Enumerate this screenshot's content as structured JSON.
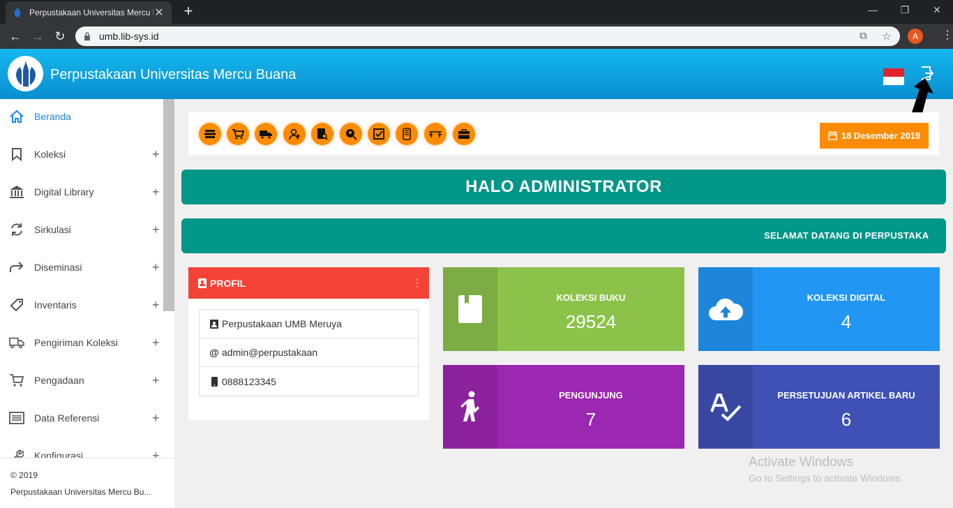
{
  "browser": {
    "tab_title": "Perpustakaan Universitas Mercu Buana",
    "url": "umb.lib-sys.id",
    "profile_initial": "A"
  },
  "header": {
    "title": "Perpustakaan Universitas Mercu Buana"
  },
  "sidebar": {
    "items": [
      {
        "label": "Beranda",
        "icon": "home-icon"
      },
      {
        "label": "Koleksi",
        "icon": "bookmark-icon"
      },
      {
        "label": "Digital Library",
        "icon": "bank-icon"
      },
      {
        "label": "Sirkulasi",
        "icon": "refresh-icon"
      },
      {
        "label": "Diseminasi",
        "icon": "share-arrow-icon"
      },
      {
        "label": "Inventaris",
        "icon": "tag-icon"
      },
      {
        "label": "Pengiriman Koleksi",
        "icon": "truck-icon"
      },
      {
        "label": "Pengadaan",
        "icon": "cart-icon"
      },
      {
        "label": "Data Referensi",
        "icon": "list-icon"
      },
      {
        "label": "Konfigurasi",
        "icon": "wrench-icon"
      }
    ],
    "plus": "+",
    "footer_copyright": "© 2019",
    "footer_org": "Perpustakaan Universitas Mercu Bu..."
  },
  "quickbar": {
    "date": "18 Desember 2019"
  },
  "banner": {
    "greeting": "HALO ADMINISTRATOR",
    "marquee": "SELAMAT DATANG DI PERPUSTAKA"
  },
  "profile": {
    "title": "PROFIL",
    "name": "Perpustakaan UMB Meruya",
    "email": "admin@perpustakaan",
    "phone": "0888123345"
  },
  "stats": [
    {
      "label": "KOLEKSI BUKU",
      "value": "29524",
      "color": "#8bc34a",
      "icon_color": "#7cac43"
    },
    {
      "label": "KOLEKSI DIGITAL",
      "value": "4",
      "color": "#2196f3",
      "icon_color": "#1e86da"
    },
    {
      "label": "PENGUNJUNG",
      "value": "7",
      "color": "#9c27b0",
      "icon_color": "#8c229e"
    },
    {
      "label": "PERSETUJUAN ARTIKEL BARU",
      "value": "6",
      "color": "#3f51b5",
      "icon_color": "#3848a2"
    }
  ],
  "watermark": {
    "line1": "Activate Windows",
    "line2": "Go to Settings to activate Windows."
  },
  "colors": {
    "header_gradient_top": "#14b8ee",
    "teal": "#009688",
    "orange": "#ff8c00",
    "red": "#f44336"
  }
}
